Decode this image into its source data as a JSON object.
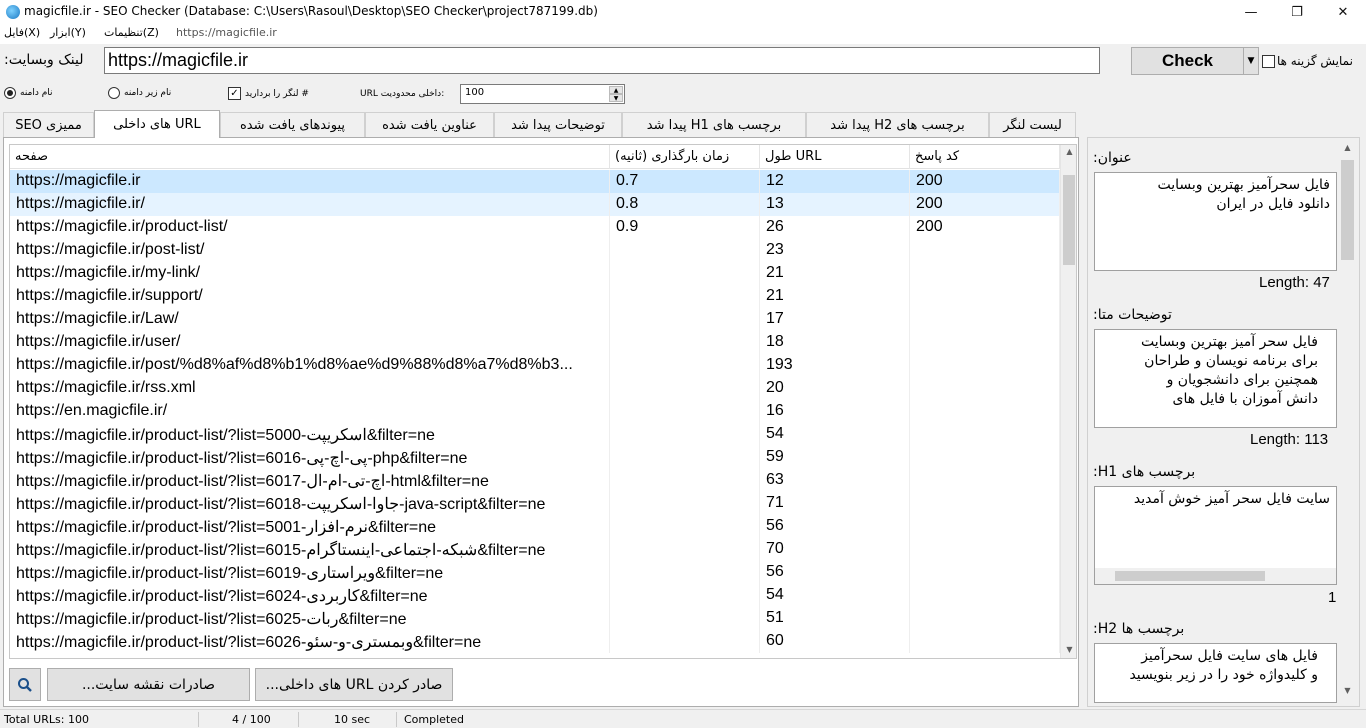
{
  "window": {
    "title": "magicfile.ir - SEO Checker (Database: C:\\Users\\Rasoul\\Desktop\\SEO Checker\\project787199.db)"
  },
  "menubar": {
    "items": [
      "فایل(X)",
      "ابزار(Y)",
      "تنظیمات(Z)"
    ],
    "current_url": "https://magicfile.ir"
  },
  "url_bar": {
    "label": "لینک وبسایت:",
    "value": "https://magicfile.ir",
    "check_label": "Check",
    "show_options_label": "نمایش گزینه ها"
  },
  "options": {
    "domain_name": "نام دامنه",
    "subdomain_name": "نام زیر دامنه",
    "strip_anchor": "لنگر را بردارید #",
    "internal_limit": "URL داخلی محدودیت:",
    "limit_value": "100"
  },
  "tabs": [
    "لیست لنگر",
    "پیدا شد H2 برچسب های",
    "پیدا شد H1 برچسب های",
    "توضیحات پیدا شد",
    "عناوین یافت شده",
    "پیوندهای یافت شده",
    "های داخلی URL",
    "SEO ممیزی"
  ],
  "table": {
    "headers": {
      "page": "صفحه",
      "load_time": "زمان بارگذاری (ثانیه)",
      "url_length": "طول URL",
      "status": "کد پاسخ"
    },
    "rows": [
      {
        "page": "https://magicfile.ir",
        "load": "0.7",
        "len": "12",
        "code": "200"
      },
      {
        "page": "https://magicfile.ir/",
        "load": "0.8",
        "len": "13",
        "code": "200"
      },
      {
        "page": "https://magicfile.ir/product-list/",
        "load": "0.9",
        "len": "26",
        "code": "200"
      },
      {
        "page": "https://magicfile.ir/post-list/",
        "load": "",
        "len": "23",
        "code": ""
      },
      {
        "page": "https://magicfile.ir/my-link/",
        "load": "",
        "len": "21",
        "code": ""
      },
      {
        "page": "https://magicfile.ir/support/",
        "load": "",
        "len": "21",
        "code": ""
      },
      {
        "page": "https://magicfile.ir/Law/",
        "load": "",
        "len": "17",
        "code": ""
      },
      {
        "page": "https://magicfile.ir/user/",
        "load": "",
        "len": "18",
        "code": ""
      },
      {
        "page": "https://magicfile.ir/post/%d8%af%d8%b1%d8%ae%d9%88%d8%a7%d8%b3...",
        "load": "",
        "len": "193",
        "code": ""
      },
      {
        "page": "https://magicfile.ir/rss.xml",
        "load": "",
        "len": "20",
        "code": ""
      },
      {
        "page": "https://en.magicfile.ir/",
        "load": "",
        "len": "16",
        "code": ""
      },
      {
        "page": "https://magicfile.ir/product-list/?list=5000-اسکریپت&filter=ne",
        "load": "",
        "len": "54",
        "code": ""
      },
      {
        "page": "https://magicfile.ir/product-list/?list=6016-پی-اچ-پی-php&filter=ne",
        "load": "",
        "len": "59",
        "code": ""
      },
      {
        "page": "https://magicfile.ir/product-list/?list=6017-اچ-تی-ام-ال-html&filter=ne",
        "load": "",
        "len": "63",
        "code": ""
      },
      {
        "page": "https://magicfile.ir/product-list/?list=6018-جاوا-اسکریپت-java-script&filter=ne",
        "load": "",
        "len": "71",
        "code": ""
      },
      {
        "page": "https://magicfile.ir/product-list/?list=5001-نرم-افزار&filter=ne",
        "load": "",
        "len": "56",
        "code": ""
      },
      {
        "page": "https://magicfile.ir/product-list/?list=6015-شبکه-اجتماعی-اینستاگرام&filter=ne",
        "load": "",
        "len": "70",
        "code": ""
      },
      {
        "page": "https://magicfile.ir/product-list/?list=6019-ویراستاری&filter=ne",
        "load": "",
        "len": "56",
        "code": ""
      },
      {
        "page": "https://magicfile.ir/product-list/?list=6024-کاربردی&filter=ne",
        "load": "",
        "len": "54",
        "code": ""
      },
      {
        "page": "https://magicfile.ir/product-list/?list=6025-ربات&filter=ne",
        "load": "",
        "len": "51",
        "code": ""
      },
      {
        "page": "https://magicfile.ir/product-list/?list=6026-وبمستری-و-سئو&filter=ne",
        "load": "",
        "len": "60",
        "code": ""
      }
    ]
  },
  "buttons": {
    "export_sitemap": "صادرات نقشه سایت...",
    "export_urls": "صادر کردن URL های داخلی..."
  },
  "side": {
    "title_label": "عنوان:",
    "title_text": "فایل سحرآمیز بهترین وبسایت\nدانلود فایل در ایران",
    "title_length": "Length: 47",
    "meta_label": "توضیحات متا:",
    "meta_text": "فایل سحر آمیز بهترین وبسایت\nبرای برنامه نویسان و طراحان\nهمچنین برای دانشجویان و\nدانش آموزان با فایل های",
    "meta_length": "Length: 113",
    "h1_label": "برچسب های H1:",
    "h1_text": "سایت فایل سحر آمیز خوش آمدید",
    "h1_count": "1",
    "h2_label": "برچسب ها H2:",
    "h2_text": "فایل های سایت فایل سحرآمیز\nو کلیدواژه خود را در زیر بنویسید"
  },
  "status": {
    "total": "Total URLs: 100",
    "progress": "4 / 100",
    "time": "10 sec",
    "state": "Completed"
  }
}
